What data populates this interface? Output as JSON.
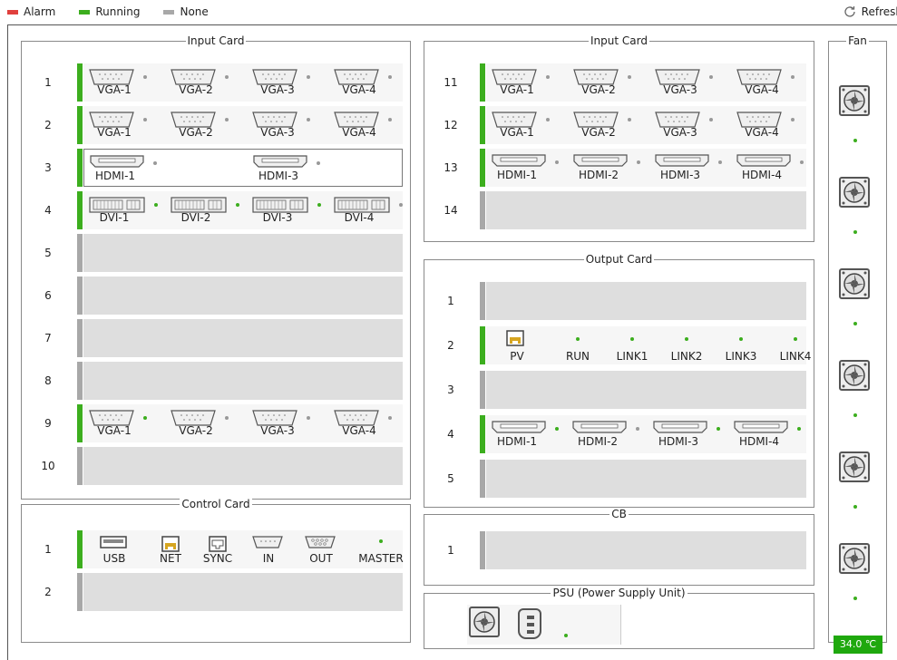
{
  "legend": {
    "alarm": "Alarm",
    "running": "Running",
    "none": "None"
  },
  "colors": {
    "alarm": "#e0403d",
    "running": "#3cae1e",
    "none": "#a8a8a8"
  },
  "refresh": "Refresh",
  "input_card_left": {
    "title": "Input Card",
    "rows": [
      {
        "n": "1",
        "state": "running",
        "ports": [
          {
            "label": "VGA-1",
            "type": "vga",
            "led": "off"
          },
          {
            "label": "VGA-2",
            "type": "vga",
            "led": "off"
          },
          {
            "label": "VGA-3",
            "type": "vga",
            "led": "off"
          },
          {
            "label": "VGA-4",
            "type": "vga",
            "led": "off"
          }
        ]
      },
      {
        "n": "2",
        "state": "running",
        "ports": [
          {
            "label": "VGA-1",
            "type": "vga",
            "led": "off"
          },
          {
            "label": "VGA-2",
            "type": "vga",
            "led": "off"
          },
          {
            "label": "VGA-3",
            "type": "vga",
            "led": "off"
          },
          {
            "label": "VGA-4",
            "type": "vga",
            "led": "off"
          }
        ]
      },
      {
        "n": "3",
        "state": "selected",
        "ports": [
          {
            "label": "HDMI-1",
            "type": "hdmi",
            "led": "off"
          },
          null,
          {
            "label": "HDMI-3",
            "type": "hdmi",
            "led": "off"
          },
          null
        ]
      },
      {
        "n": "4",
        "state": "running",
        "ports": [
          {
            "label": "DVI-1",
            "type": "dvi",
            "led": "on"
          },
          {
            "label": "DVI-2",
            "type": "dvi",
            "led": "on"
          },
          {
            "label": "DVI-3",
            "type": "dvi",
            "led": "on"
          },
          {
            "label": "DVI-4",
            "type": "dvi",
            "led": "off"
          }
        ]
      },
      {
        "n": "5",
        "state": "none",
        "ports": []
      },
      {
        "n": "6",
        "state": "none",
        "ports": []
      },
      {
        "n": "7",
        "state": "none",
        "ports": []
      },
      {
        "n": "8",
        "state": "none",
        "ports": []
      },
      {
        "n": "9",
        "state": "running",
        "ports": [
          {
            "label": "VGA-1",
            "type": "vga",
            "led": "on"
          },
          {
            "label": "VGA-2",
            "type": "vga",
            "led": "off"
          },
          {
            "label": "VGA-3",
            "type": "vga",
            "led": "off"
          },
          {
            "label": "VGA-4",
            "type": "vga",
            "led": "off"
          }
        ]
      },
      {
        "n": "10",
        "state": "none",
        "ports": []
      }
    ]
  },
  "input_card_right": {
    "title": "Input Card",
    "rows": [
      {
        "n": "11",
        "state": "running",
        "ports": [
          {
            "label": "VGA-1",
            "type": "vga",
            "led": "off"
          },
          {
            "label": "VGA-2",
            "type": "vga",
            "led": "off"
          },
          {
            "label": "VGA-3",
            "type": "vga",
            "led": "off"
          },
          {
            "label": "VGA-4",
            "type": "vga",
            "led": "off"
          }
        ]
      },
      {
        "n": "12",
        "state": "running",
        "ports": [
          {
            "label": "VGA-1",
            "type": "vga",
            "led": "off"
          },
          {
            "label": "VGA-2",
            "type": "vga",
            "led": "off"
          },
          {
            "label": "VGA-3",
            "type": "vga",
            "led": "off"
          },
          {
            "label": "VGA-4",
            "type": "vga",
            "led": "off"
          }
        ]
      },
      {
        "n": "13",
        "state": "running",
        "ports": [
          {
            "label": "HDMI-1",
            "type": "hdmi",
            "led": "off"
          },
          {
            "label": "HDMI-2",
            "type": "hdmi",
            "led": "off"
          },
          {
            "label": "HDMI-3",
            "type": "hdmi",
            "led": "off"
          },
          {
            "label": "HDMI-4",
            "type": "hdmi",
            "led": "off"
          }
        ]
      },
      {
        "n": "14",
        "state": "none",
        "ports": []
      }
    ]
  },
  "output_card": {
    "title": "Output Card",
    "rows": [
      {
        "n": "1",
        "state": "none",
        "kind": "empty"
      },
      {
        "n": "2",
        "state": "running",
        "kind": "status",
        "pv": "PV",
        "leds": [
          "RUN",
          "LINK1",
          "LINK2",
          "LINK3",
          "LINK4"
        ]
      },
      {
        "n": "3",
        "state": "none",
        "kind": "empty"
      },
      {
        "n": "4",
        "state": "running",
        "kind": "ports",
        "ports": [
          {
            "label": "HDMI-1",
            "type": "hdmi",
            "led": "on"
          },
          {
            "label": "HDMI-2",
            "type": "hdmi",
            "led": "off"
          },
          {
            "label": "HDMI-3",
            "type": "hdmi",
            "led": "on"
          },
          {
            "label": "HDMI-4",
            "type": "hdmi",
            "led": "on"
          }
        ]
      },
      {
        "n": "5",
        "state": "none",
        "kind": "empty"
      }
    ]
  },
  "control_card": {
    "title": "Control Card",
    "rows": [
      {
        "n": "1",
        "state": "running",
        "items": [
          {
            "label": "USB",
            "icon": "usb-icon"
          },
          {
            "label": "NET",
            "icon": "net-icon"
          },
          {
            "label": "SYNC",
            "icon": "sync-icon"
          },
          {
            "label": "IN",
            "icon": "serial-in-icon"
          },
          {
            "label": "OUT",
            "icon": "serial-out-icon"
          },
          {
            "label": "MASTER",
            "icon": "led-icon"
          }
        ]
      },
      {
        "n": "2",
        "state": "none",
        "items": []
      }
    ]
  },
  "cb": {
    "title": "CB",
    "rows": [
      {
        "n": "1",
        "state": "none"
      }
    ]
  },
  "psu": {
    "title": "PSU (Power Supply Unit)",
    "led": "on"
  },
  "fan": {
    "title": "Fan",
    "count": 6,
    "temperature": "34.0 ℃"
  }
}
